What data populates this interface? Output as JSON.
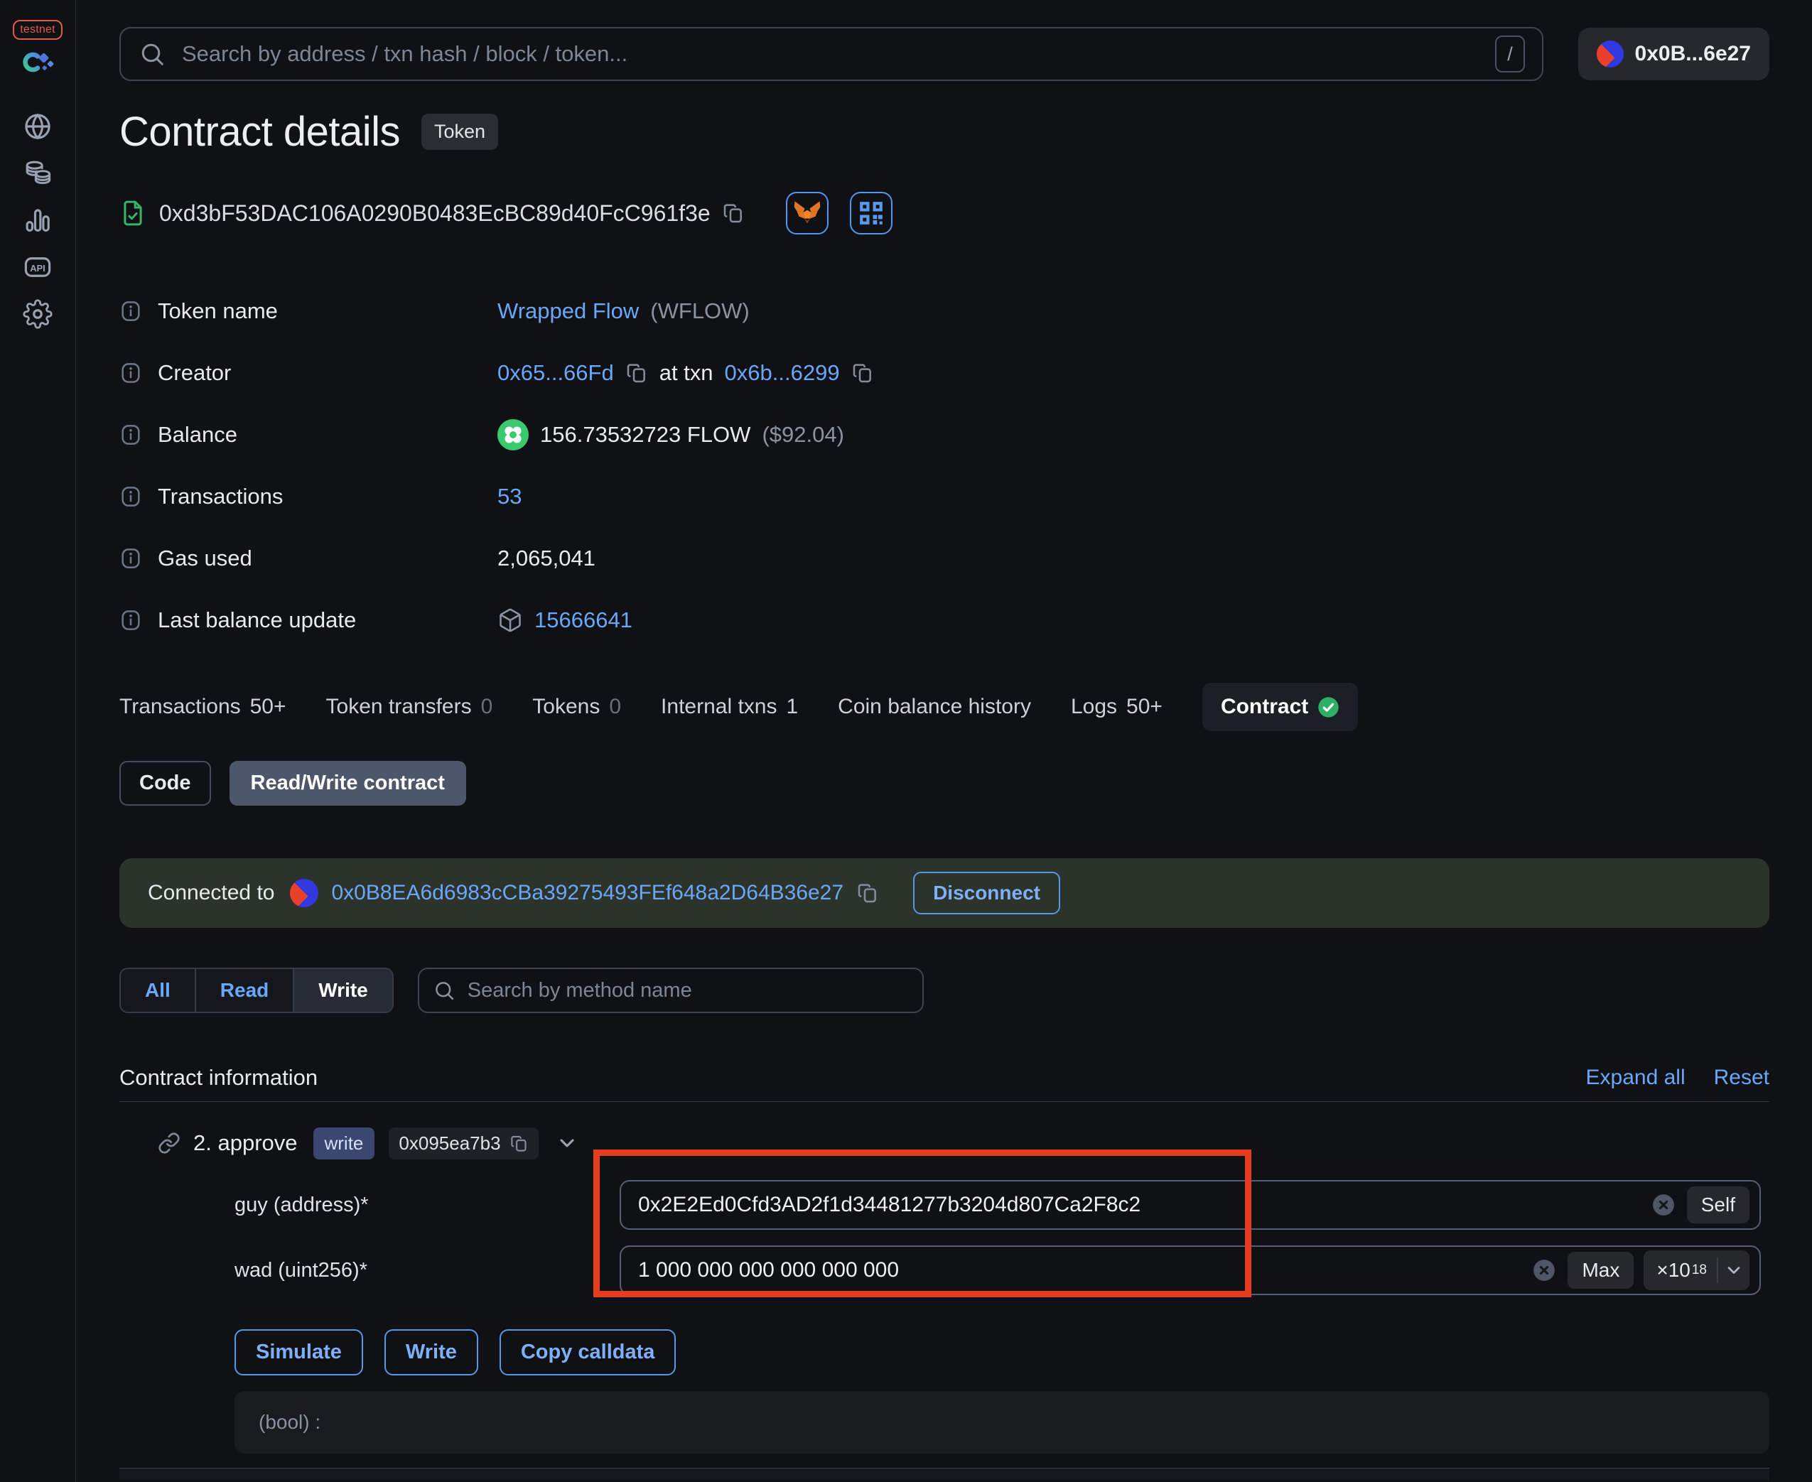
{
  "colors": {
    "accent_blue": "#6aa7f8",
    "success_green": "#2fae68",
    "flow_green": "#3bc96f",
    "testnet_red": "#e15a4a",
    "annotation_red": "#e63d20",
    "wallet_banner_bg": "#2b332b"
  },
  "sidebar": {
    "network_badge": "testnet"
  },
  "topbar": {
    "search_placeholder": "Search by address / txn hash / block / token...",
    "shortcut_hint": "/",
    "account_label": "0x0B...6e27"
  },
  "page_header": {
    "title": "Contract details",
    "type_badge": "Token",
    "address": "0xd3bF53DAC106A0290B0483EcBC89d40FcC961f3e"
  },
  "info_rows": [
    {
      "label": "Token name",
      "link": "Wrapped Flow",
      "suffix": "(WFLOW)"
    },
    {
      "label": "Creator",
      "link": "0x65...66Fd",
      "mid": "at txn",
      "link2": "0x6b...6299"
    },
    {
      "label": "Balance",
      "value": "156.73532723 FLOW",
      "usd": "($92.04)"
    },
    {
      "label": "Transactions",
      "link": "53"
    },
    {
      "label": "Gas used",
      "value": "2,065,041"
    },
    {
      "label": "Last balance update",
      "link": "15666641"
    }
  ],
  "tabs": [
    {
      "label": "Transactions",
      "count": "50+"
    },
    {
      "label": "Token transfers",
      "count": "0"
    },
    {
      "label": "Tokens",
      "count": "0"
    },
    {
      "label": "Internal txns",
      "count": "1"
    },
    {
      "label": "Coin balance history"
    },
    {
      "label": "Logs",
      "count": "50+"
    },
    {
      "label": "Contract",
      "selected": true
    }
  ],
  "contract_tabs": {
    "code": "Code",
    "read_write": "Read/Write contract"
  },
  "wallet_banner": {
    "prefix": "Connected to",
    "address": "0x0B8EA6d6983cCBa39275493FEf648a2D64B36e27",
    "disconnect": "Disconnect"
  },
  "method_filter": {
    "all": "All",
    "read": "Read",
    "write": "Write",
    "selected": "Write",
    "search_placeholder": "Search by method name"
  },
  "section": {
    "title": "Contract information",
    "expand_all": "Expand all",
    "reset": "Reset"
  },
  "method": {
    "name": "2. approve",
    "type_badge": "write",
    "selector": "0x095ea7b3",
    "fields": [
      {
        "label": "guy (address)*",
        "value": "0x2E2Ed0Cfd3AD2f1d34481277b3204d807Ca2F8c2",
        "action": "Self"
      },
      {
        "label": "wad (uint256)*",
        "value": "1 000 000 000 000 000 000",
        "action": "Max",
        "multiplier": "×10",
        "exponent": "18"
      }
    ],
    "actions": {
      "simulate": "Simulate",
      "write": "Write",
      "copy_calldata": "Copy calldata"
    },
    "output": "(bool) :"
  }
}
